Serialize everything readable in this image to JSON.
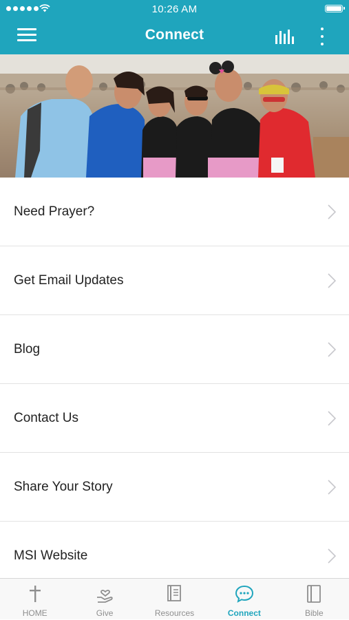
{
  "status_bar": {
    "time": "10:26 AM"
  },
  "nav": {
    "title": "Connect"
  },
  "menu": [
    {
      "label": "Need Prayer?"
    },
    {
      "label": "Get Email Updates"
    },
    {
      "label": "Blog"
    },
    {
      "label": "Contact Us"
    },
    {
      "label": "Share Your Story"
    },
    {
      "label": "MSI Website"
    }
  ],
  "tabs": [
    {
      "label": "HOME",
      "icon": "cross-icon"
    },
    {
      "label": "Give",
      "icon": "heart-hand-icon"
    },
    {
      "label": "Resources",
      "icon": "book-icon"
    },
    {
      "label": "Connect",
      "icon": "chat-bubble-icon",
      "active": true
    },
    {
      "label": "Bible",
      "icon": "bible-icon"
    }
  ],
  "colors": {
    "brand": "#1fa5bd",
    "tab_inactive": "#8e8e8e",
    "divider": "#e2e2e2"
  }
}
